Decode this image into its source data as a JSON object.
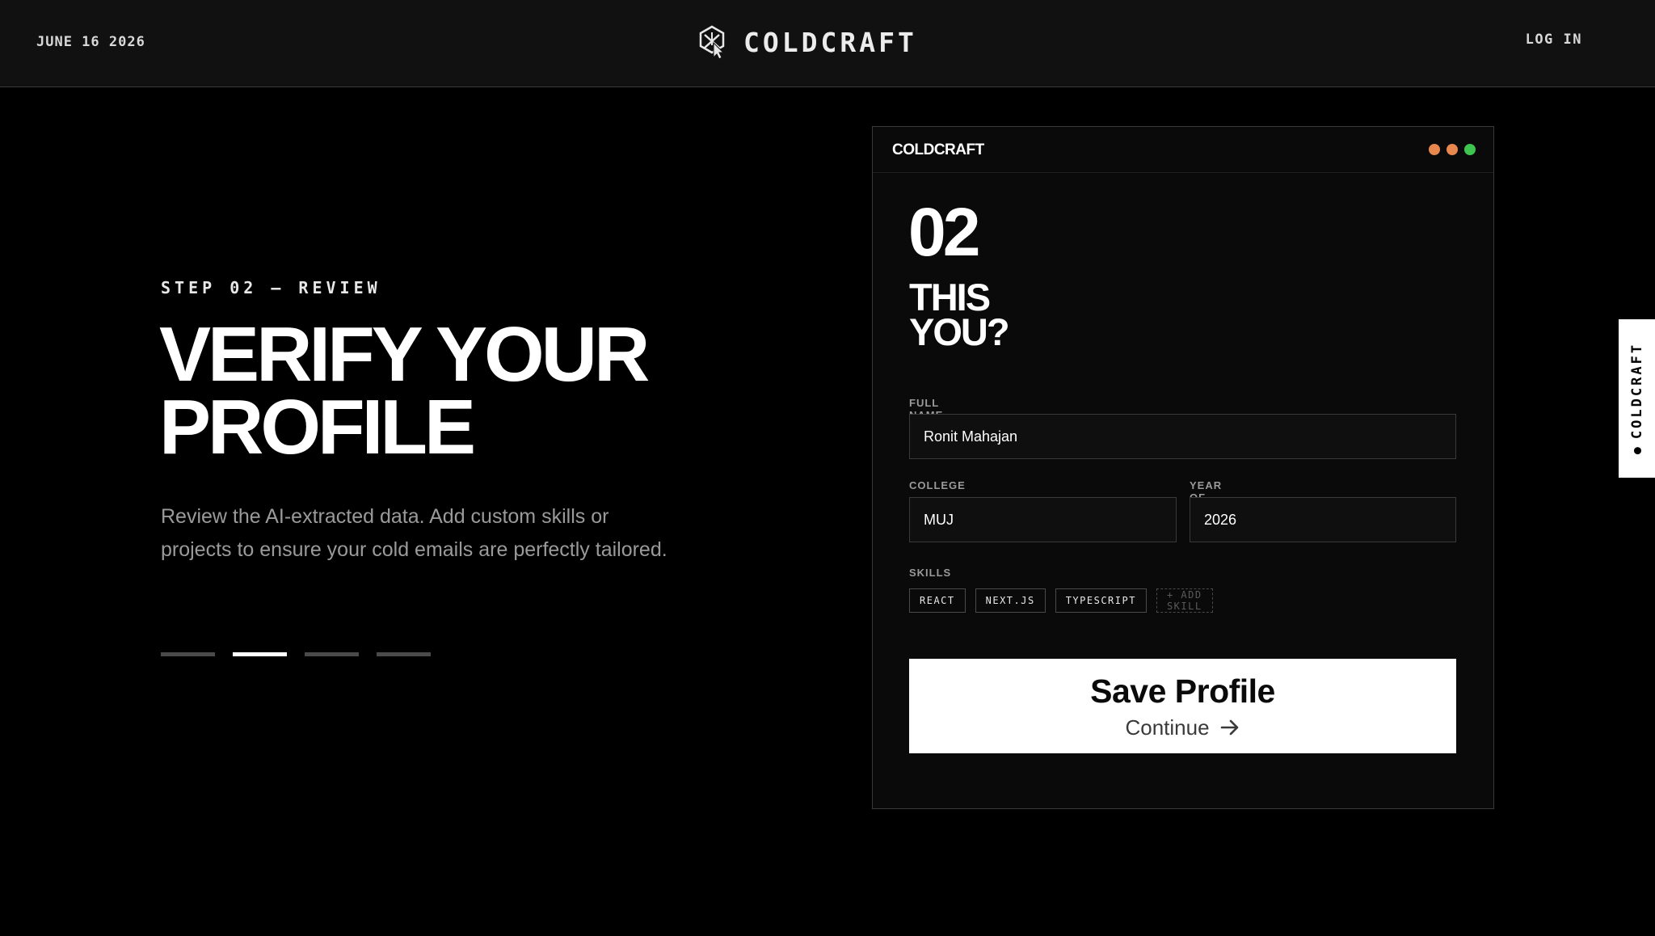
{
  "header": {
    "date": "JUNE 16 2026",
    "brand": "COLDCRAFT",
    "login_label": "LOG IN"
  },
  "hero": {
    "step_label": "STEP 02 — REVIEW",
    "headline_line1": "VERIFY YOUR",
    "headline_line2": "PROFILE",
    "description": "Review the AI-extracted data. Add custom skills or projects to ensure your cold emails are perfectly tailored.",
    "progress": {
      "total_steps": 4,
      "current_step": 2
    }
  },
  "card": {
    "brand": "COLDCRAFT",
    "window_dot_colors": [
      "#e8884f",
      "#e8884f",
      "#3ec54f"
    ],
    "step_number": "02",
    "question_line1": "THIS",
    "question_line2": "YOU?",
    "fields": {
      "full_name": {
        "label": "FULL NAME",
        "value": "Ronit Mahajan"
      },
      "college": {
        "label": "COLLEGE",
        "value": "MUJ"
      },
      "year_of_study": {
        "label": "YEAR OF STUDY",
        "value": "2026"
      }
    },
    "skills": {
      "label": "SKILLS",
      "items": [
        "REACT",
        "NEXT.JS",
        "TYPESCRIPT"
      ],
      "add_label": "+ ADD SKILL"
    },
    "primary_button": {
      "label": "Save Profile",
      "sublabel": "Continue",
      "icon": "arrow-right-icon"
    }
  },
  "side_tab": {
    "label": "COLDCRAFT"
  }
}
